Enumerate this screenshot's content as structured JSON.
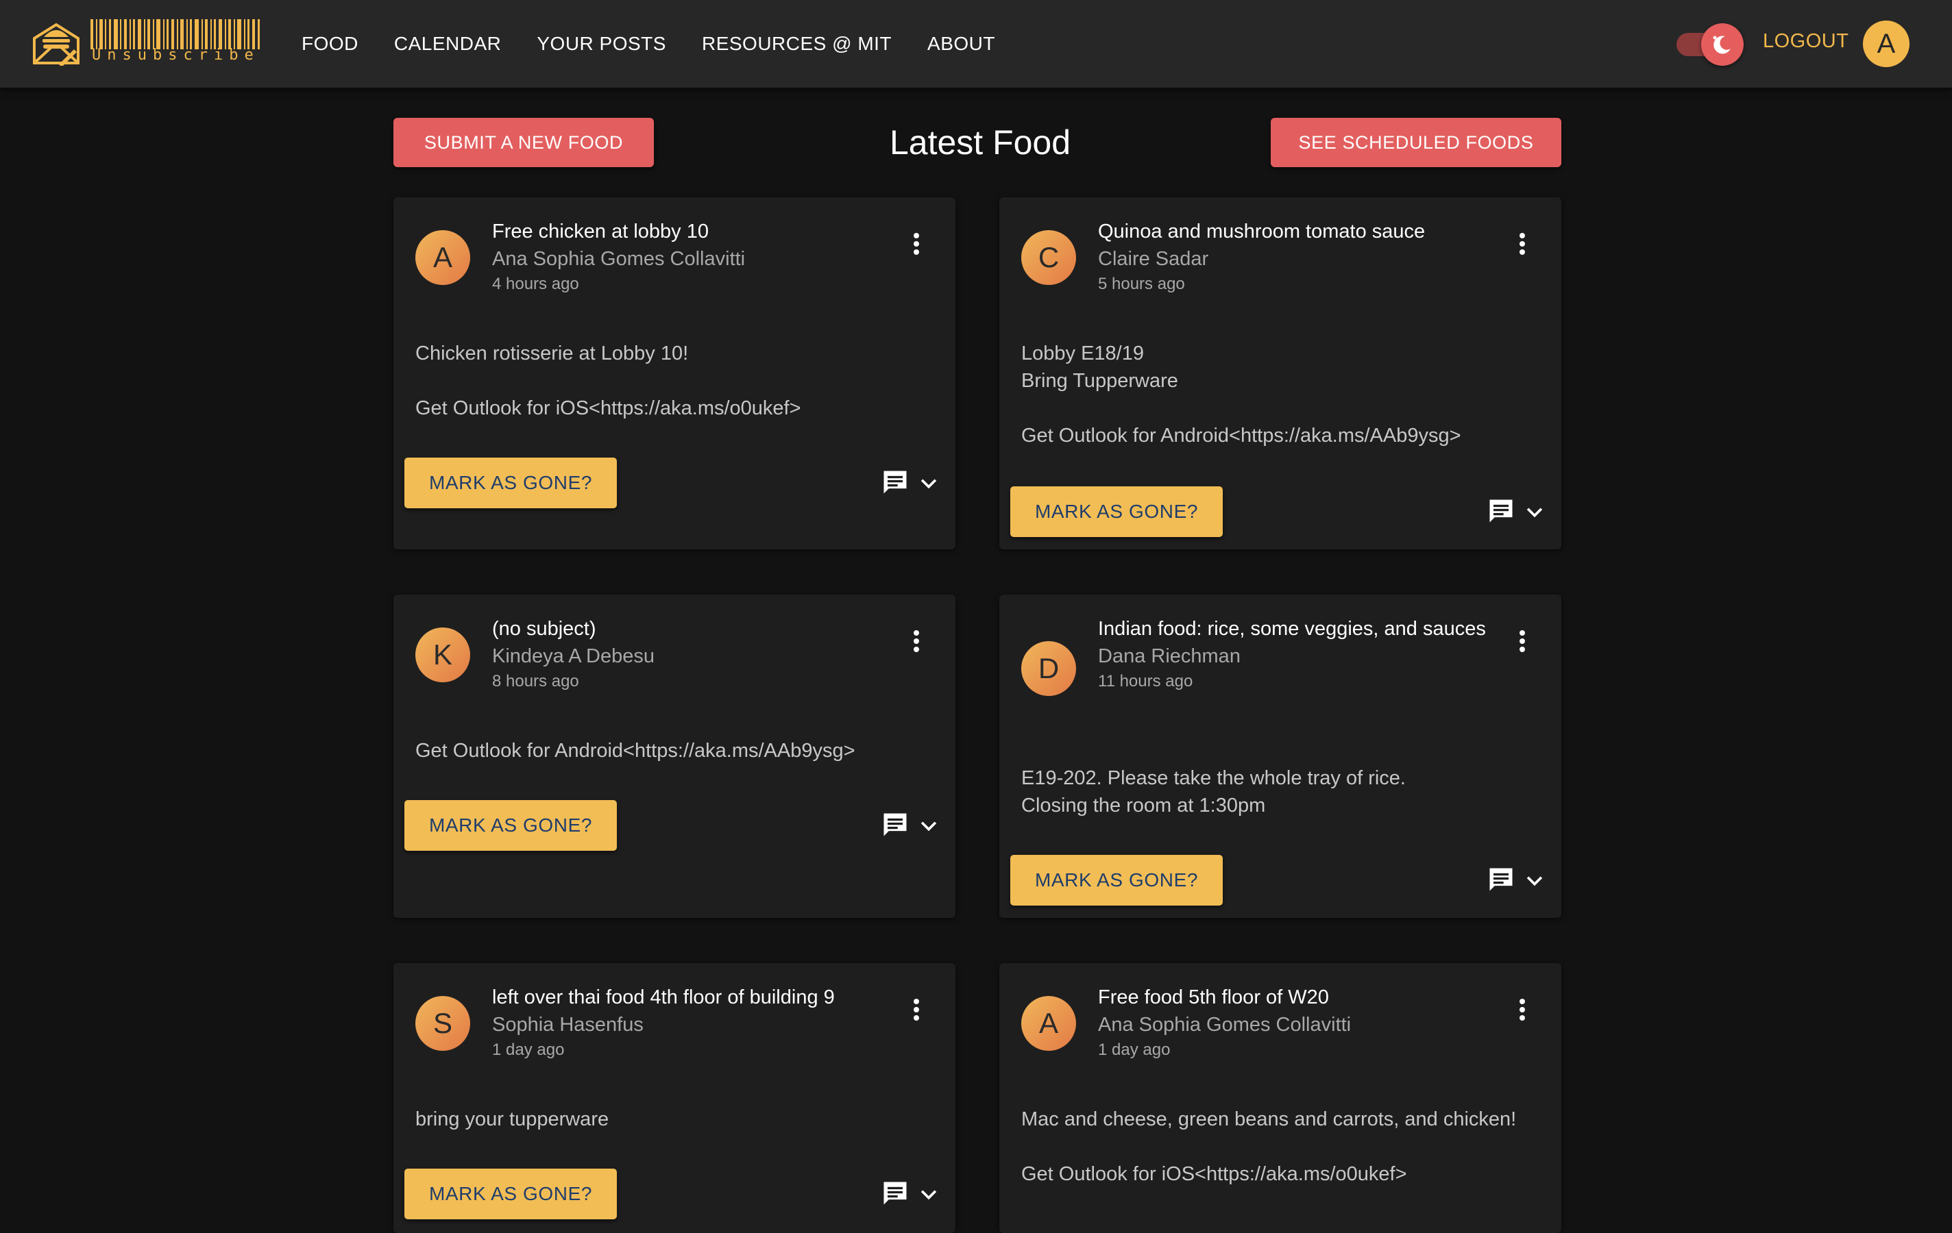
{
  "header": {
    "logo_text": "Unsubscribe",
    "nav": [
      "FOOD",
      "CALENDAR",
      "YOUR POSTS",
      "RESOURCES @ MIT",
      "ABOUT"
    ],
    "logout_label": "LOGOUT",
    "user_initial": "A",
    "dark_mode": true
  },
  "toolbar": {
    "submit_label": "SUBMIT A NEW FOOD",
    "title": "Latest Food",
    "scheduled_label": "SEE SCHEDULED FOODS"
  },
  "mark_gone_label": "MARK AS GONE?",
  "posts": [
    {
      "initial": "A",
      "title": "Free chicken at lobby 10",
      "author": "Ana Sophia Gomes Collavitti",
      "time": "4 hours ago",
      "body": [
        "Chicken rotisserie at Lobby 10!",
        "",
        "Get Outlook for iOS<https://aka.ms/o0ukef>"
      ]
    },
    {
      "initial": "C",
      "title": "Quinoa and mushroom tomato sauce",
      "author": "Claire Sadar",
      "time": "5 hours ago",
      "body": [
        "Lobby E18/19",
        "Bring Tupperware",
        "",
        "Get Outlook for Android<https://aka.ms/AAb9ysg>"
      ]
    },
    {
      "initial": "K",
      "title": "(no subject)",
      "author": "Kindeya A Debesu",
      "time": "8 hours ago",
      "body": [
        "Get Outlook for Android<https://aka.ms/AAb9ysg>"
      ]
    },
    {
      "initial": "D",
      "title": "Indian food: rice, some veggies, and sauces",
      "author": "Dana Riechman",
      "time": "11 hours ago",
      "body": [
        "E19-202. Please take the whole tray of rice.",
        "Closing the room at 1:30pm"
      ]
    },
    {
      "initial": "S",
      "title": "left over thai food 4th floor of building 9",
      "author": "Sophia Hasenfus",
      "time": "1 day ago",
      "body": [
        "bring your tupperware"
      ]
    },
    {
      "initial": "A",
      "title": "Free food 5th floor of W20",
      "author": "Ana Sophia Gomes Collavitti",
      "time": "1 day ago",
      "body": [
        "Mac and cheese, green beans and carrots, and chicken!",
        "",
        "Get Outlook for iOS<https://aka.ms/o0ukef>"
      ]
    }
  ],
  "colors": {
    "background": "#121212",
    "appbar": "#272727",
    "card": "#1e1e1e",
    "accent_gold": "#f2bd55",
    "accent_red": "#e35f5f",
    "button_text_blue": "#1f3d6b"
  }
}
